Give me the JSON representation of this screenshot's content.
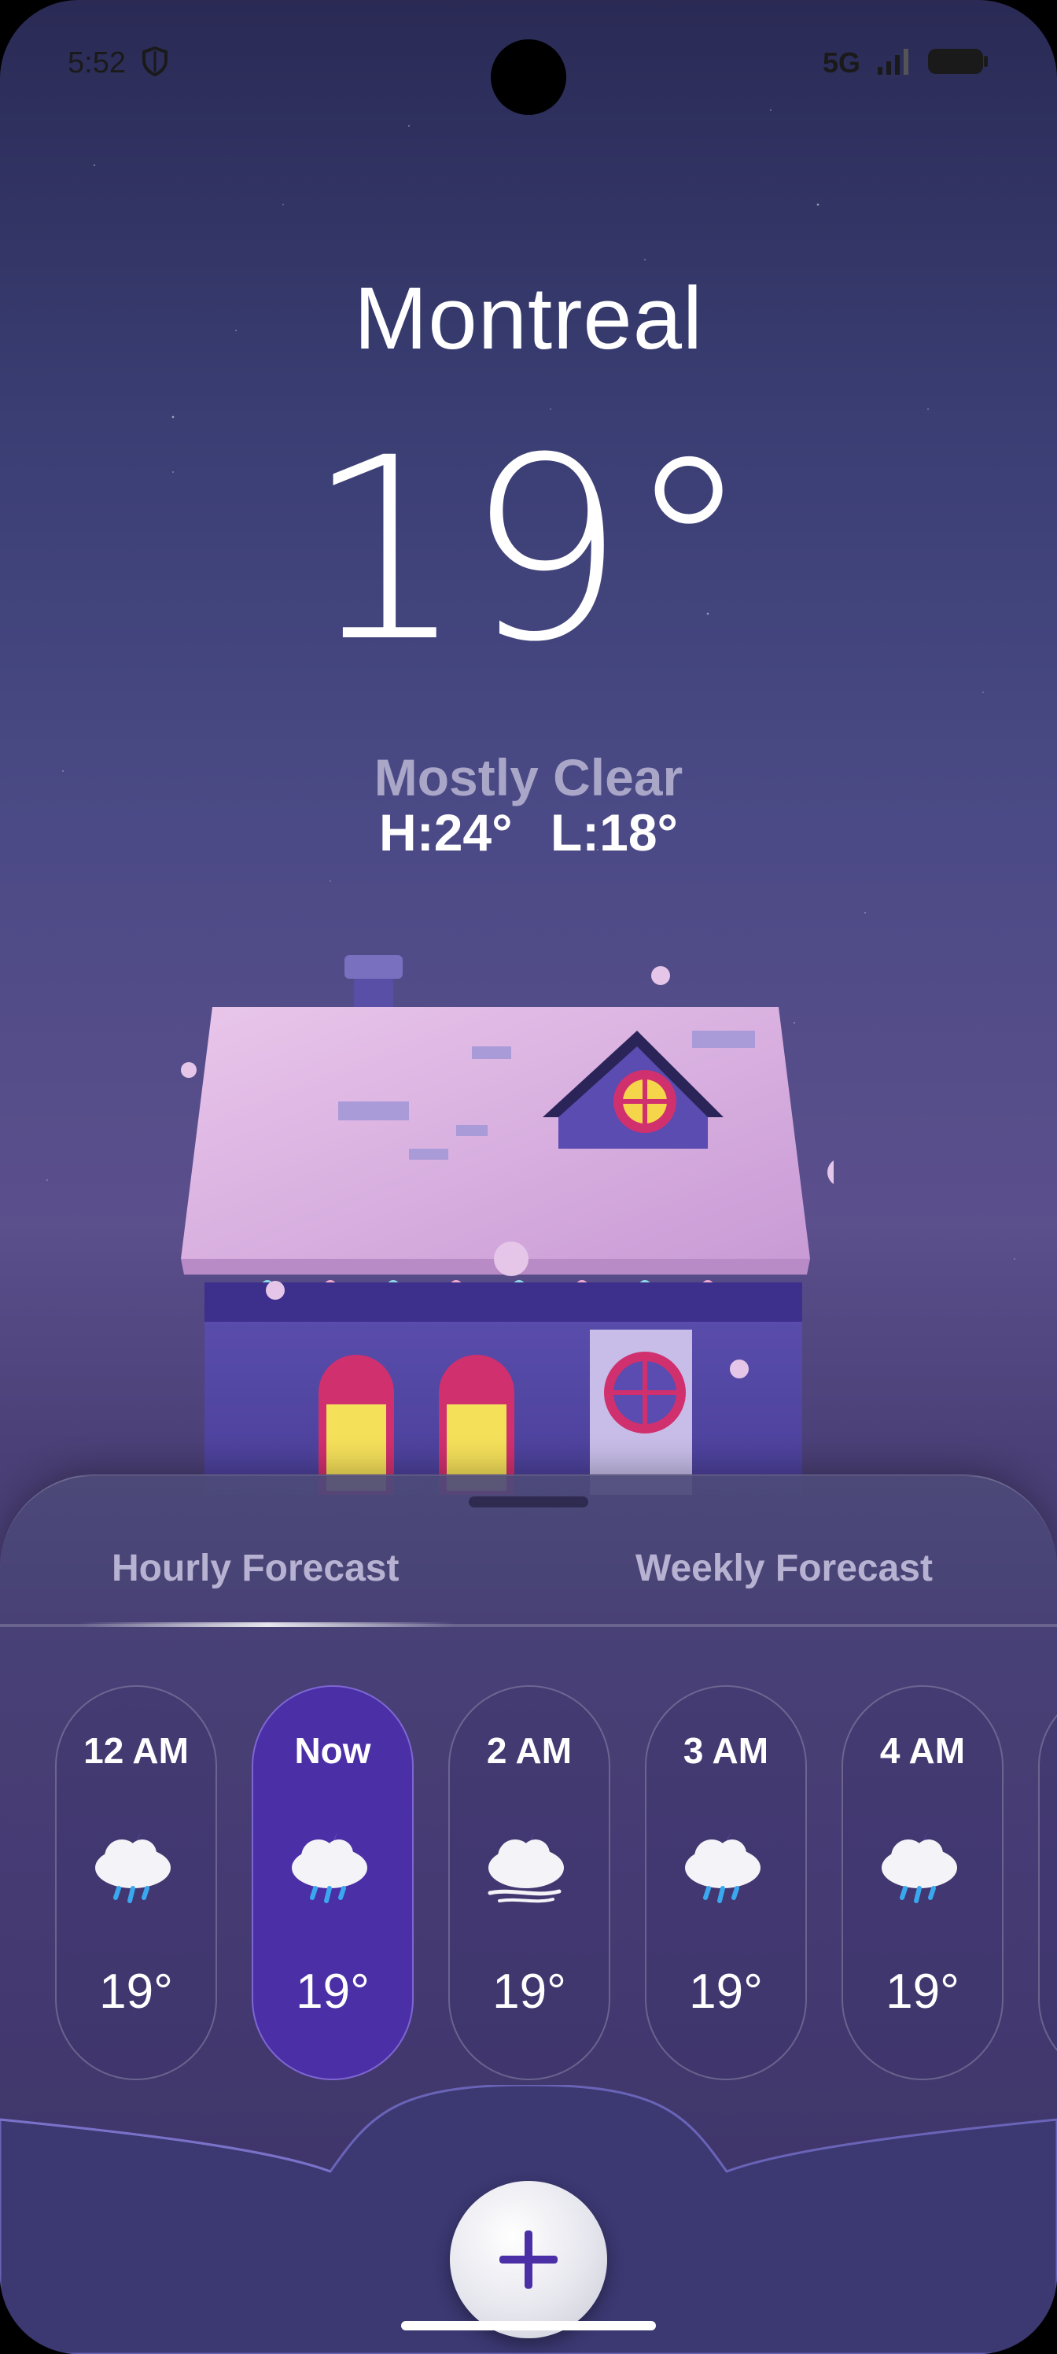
{
  "status_bar": {
    "time": "5:52",
    "network": "5G",
    "icons": [
      "shield-icon",
      "signal-icon",
      "battery-icon"
    ]
  },
  "weather": {
    "city": "Montreal",
    "temperature": "19°",
    "condition": "Mostly Clear",
    "hilo": "H:24°   L:18°"
  },
  "tabs": {
    "hourly": "Hourly Forecast",
    "weekly": "Weekly Forecast"
  },
  "hourly": [
    {
      "time": "12 AM",
      "temp": "19°",
      "icon": "night-rain-cloud-icon",
      "active": false
    },
    {
      "time": "Now",
      "temp": "19°",
      "icon": "night-rain-cloud-icon",
      "active": true
    },
    {
      "time": "2 AM",
      "temp": "19°",
      "icon": "night-windy-cloud-icon",
      "active": false
    },
    {
      "time": "3 AM",
      "temp": "19°",
      "icon": "night-rain-cloud-icon",
      "active": false
    },
    {
      "time": "4 AM",
      "temp": "19°",
      "icon": "night-rain-cloud-icon",
      "active": false
    }
  ],
  "colors": {
    "active_card": "#4b2fa6",
    "accent_plus": "#4b2fa6"
  }
}
